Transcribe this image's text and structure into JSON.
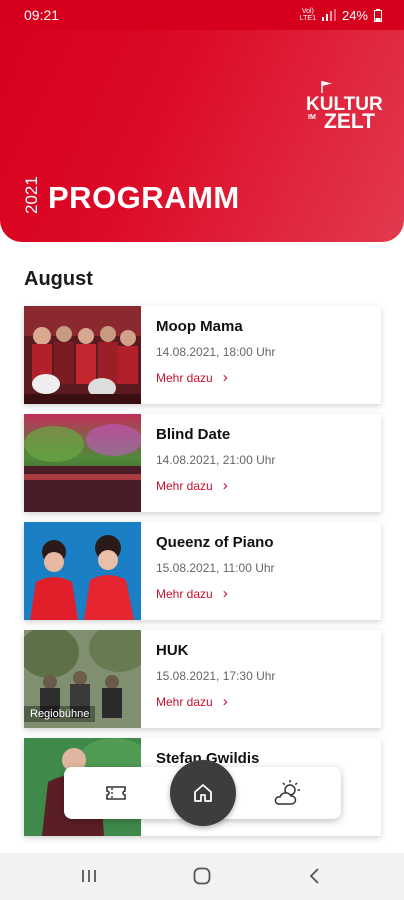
{
  "status": {
    "time": "09:21",
    "battery": "24%",
    "volte_top": "Vol)",
    "volte_bottom": "LTE1"
  },
  "header": {
    "year": "2021",
    "title": "PROGRAMM",
    "logo_top": "KULTUR",
    "logo_im": "IM",
    "logo_bottom": "ZELT"
  },
  "colors": {
    "brand_red": "#d6001c",
    "link_red": "#c8102e",
    "home_button": "#3d3d3d"
  },
  "month": "August",
  "events": [
    {
      "name": "Moop Mama",
      "date": "14.08.2021, 18:00 Uhr",
      "more": "Mehr dazu"
    },
    {
      "name": "Blind Date",
      "date": "14.08.2021, 21:00 Uhr",
      "more": "Mehr dazu"
    },
    {
      "name": "Queenz of Piano",
      "date": "15.08.2021, 11:00 Uhr",
      "more": "Mehr dazu"
    },
    {
      "name": "HUK",
      "date": "15.08.2021, 17:30 Uhr",
      "more": "Mehr dazu",
      "badge": "Regiobühne"
    },
    {
      "name": "Stefan Gwildis"
    }
  ],
  "nav": {
    "icons": [
      "ticket-icon",
      "home-icon",
      "weather-icon"
    ]
  }
}
